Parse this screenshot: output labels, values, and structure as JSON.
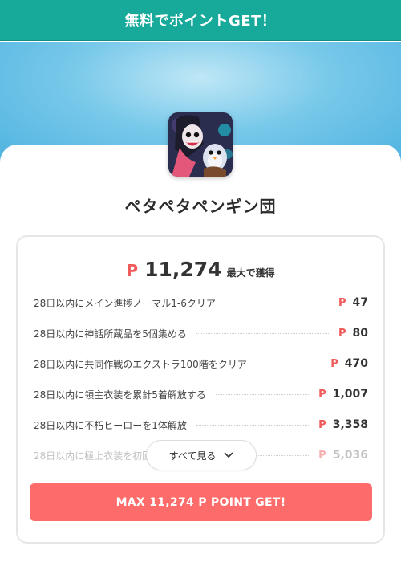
{
  "header": {
    "title": "無料でポイントGET！"
  },
  "app": {
    "name": "ペタペタペンギン団",
    "icon": "app-icon-character-art"
  },
  "reward": {
    "currency_symbol": "P",
    "total": "11,274",
    "total_suffix": "最大で獲得"
  },
  "tasks": [
    {
      "label": "28日以内にメイン進捗ノーマル1-6クリア",
      "points": "47"
    },
    {
      "label": "28日以内に神話所蔵品を5個集める",
      "points": "80"
    },
    {
      "label": "28日以内に共同作戦のエクストラ100階をクリア",
      "points": "470"
    },
    {
      "label": "28日以内に領主衣装を累計5着解放する",
      "points": "1,007"
    },
    {
      "label": "28日以内に不朽ヒーローを1体解放",
      "points": "3,358"
    },
    {
      "label": "28日以内に極上衣装を初回",
      "points": "5,036"
    }
  ],
  "see_all": {
    "label": "すべて見る",
    "icon": "chevron-down-icon"
  },
  "cta": {
    "label": "MAX 11,274 P POINT GET!"
  },
  "colors": {
    "header_bg": "#17a99a",
    "accent_red": "#f05a5a",
    "cta_bg": "#fd6c6a"
  }
}
